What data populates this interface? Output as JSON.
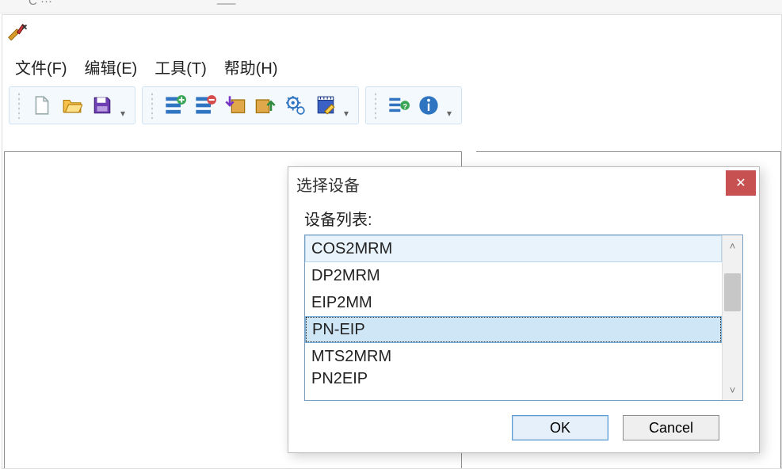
{
  "menu": {
    "file": "文件(F)",
    "edit": "编辑(E)",
    "tools": "工具(T)",
    "help": "帮助(H)"
  },
  "toolbar": {
    "group1": [
      "new-file-icon",
      "open-folder-icon",
      "save-disk-icon"
    ],
    "group2": [
      "add-node-icon",
      "remove-node-icon",
      "import-box-icon",
      "export-box-icon",
      "gear-icon",
      "notes-icon"
    ],
    "group3": [
      "help-list-icon",
      "info-icon"
    ]
  },
  "dialog": {
    "title": "选择设备",
    "list_label": "设备列表:",
    "items": [
      {
        "label": "COS2MRM",
        "state": "highlight"
      },
      {
        "label": "DP2MRM",
        "state": ""
      },
      {
        "label": "EIP2MM",
        "state": ""
      },
      {
        "label": "PN-EIP",
        "state": "selected"
      },
      {
        "label": "MTS2MRM",
        "state": ""
      },
      {
        "label": "PN2EIP",
        "state": "clip"
      }
    ],
    "ok_label": "OK",
    "cancel_label": "Cancel"
  }
}
